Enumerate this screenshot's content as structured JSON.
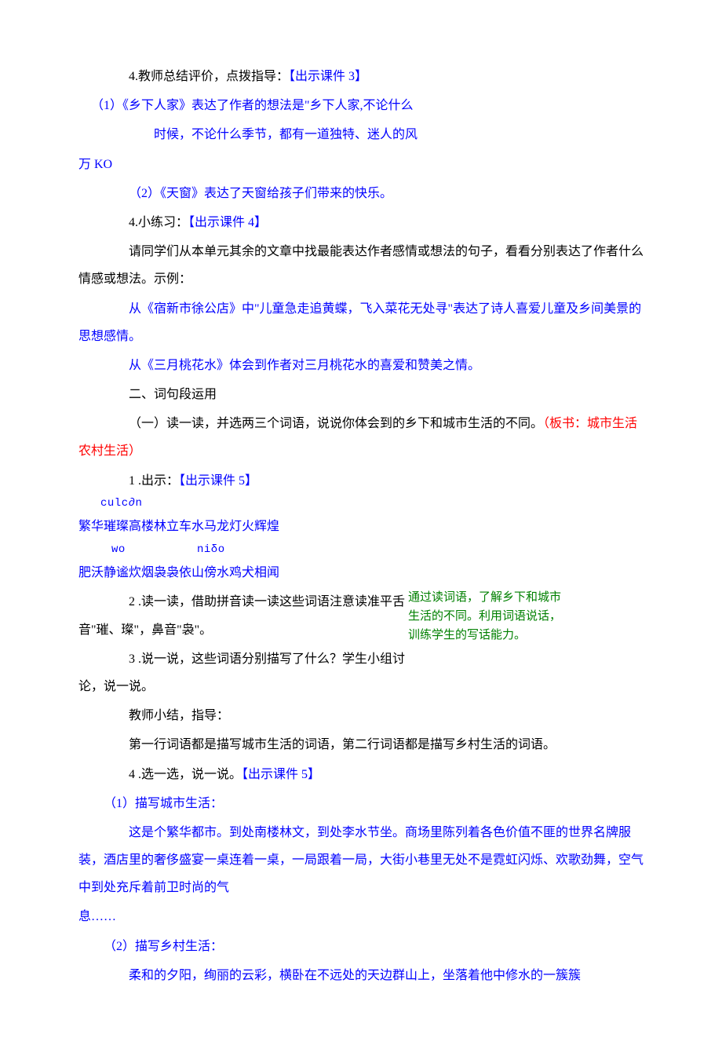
{
  "p1_pre": "4.教师总结评价，点拨指导：",
  "p1_blue": "【出示课件 3】",
  "p2_blue": "（1）《乡下人家》表达了作者的想法是\"乡下人家,不论什么",
  "p3_blue_a": "时候，不论什么季节，都有一道独特、迷人的风",
  "p3_blue_b": "万 KO",
  "p4_blue": "（2）《天窗》表达了天窗给孩子们带来的快乐。",
  "p5_pre": "4.小练习：",
  "p5_blue": "【出示课件 4】",
  "p6": "请同学们从本单元其余的文章中找最能表达作者感情或想法的句子，看看分别表达了作者什么情感或想法。示例：",
  "p7_blue": "从《宿新市徐公店》中\"儿童急走追黄蝶，飞入菜花无处寻\"表达了诗人喜爱儿童及乡间美景的思想感情。",
  "p8_blue": "从《三月桃花水》体会到作者对三月桃花水的喜爱和赞美之情。",
  "p9": "二、词句段运用",
  "p10_pre": "（一）读一读，并选两三个词语，说说你体会到的乡下和城市生活的不同。",
  "p10_red": "（板书：城市生活农村生活）",
  "p11_pre": "1 .出示：",
  "p11_blue": "【出示课件 5】",
  "pinyin1": "culc∂n",
  "words1": "繁华璀璨高楼林立车水马龙灯火辉煌",
  "pinyin2_a": "wo",
  "pinyin2_b": "niδo",
  "words2": "肥沃静谧炊烟袅袅依山傍水鸡犬相闻",
  "p12": "2 .读一读，借助拼音读一读这些词语注意读准平舌音\"璀、璨\"，鼻音\"袅\"。",
  "p13": "3 .说一说，这些词语分别描写了什么？学生小组讨论，说一说。",
  "side_note": "通过读词语，了解乡下和城市生活的不同。利用词语说话，训练学生的写话能力。",
  "p14": "教师小结，指导：",
  "p15": "第一行词语都是描写城市生活的词语，第二行词语都是描写乡村生活的词语。",
  "p16_pre": "4 .选一选，说一说。",
  "p16_blue": "【出示课件 5】",
  "p17_blue": "（1）描写城市生活：",
  "p18_blue": "这是个繁华都市。到处南楼林文，到处李水节坐。商场里陈列着各色价值不匪的世界名牌服装，酒店里的奢侈盛宴一桌连着一桌，一局跟着一局，大街小巷里无处不是霓虹闪烁、欢歌劲舞，空气中到处充斥着前卫时尚的气",
  "p18_blue_b": "息……",
  "p19_blue": "（2）描写乡村生活：",
  "p20_blue": "柔和的夕阳，绚丽的云彩，横卧在不远处的天边群山上，坐落着他中修水的一簇簇"
}
